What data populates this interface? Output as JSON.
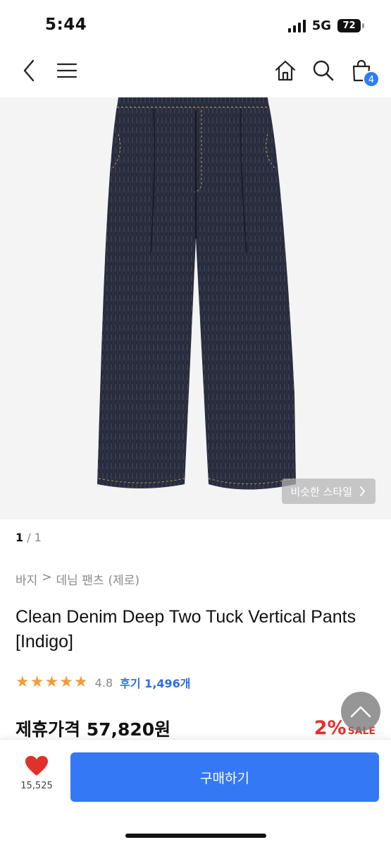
{
  "status": {
    "time": "5:44",
    "network": "5G",
    "battery": "72"
  },
  "nav": {
    "cart_count": "4"
  },
  "image": {
    "similar_style_label": "비슷한 스타일",
    "counter_current": "1",
    "counter_sep_total": " / 1"
  },
  "breadcrumb": {
    "category": "바지",
    "separator": ">",
    "subcategory": "데님 팬츠",
    "brand": "(제로)"
  },
  "product": {
    "title": "Clean Denim Deep Two Tuck Vertical Pants [Indigo]",
    "rating": "4.8",
    "rating_fraction": 0.96,
    "review_label": "후기 1,496개",
    "price_label": "제휴가격 57,820원",
    "discount_percent": "2%",
    "discount_label": "SALE"
  },
  "bottom": {
    "like_count": "15,525",
    "buy_label": "구매하기"
  },
  "colors": {
    "accent": "#3478f6",
    "sale": "#e0322b",
    "star": "#f29c3b",
    "heart": "#e0322b",
    "badge": "#2f7ef0"
  },
  "icons": [
    "back-icon",
    "menu-icon",
    "home-icon",
    "search-icon",
    "cart-icon",
    "chevron-right-icon",
    "chevron-up-icon",
    "heart-icon",
    "star-icon"
  ]
}
